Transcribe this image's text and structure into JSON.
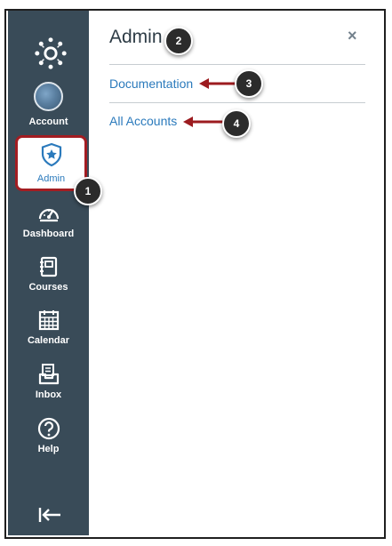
{
  "nav": {
    "items": [
      {
        "label": "Account",
        "icon": "account-avatar"
      },
      {
        "label": "Admin",
        "icon": "shield-star-icon"
      },
      {
        "label": "Dashboard",
        "icon": "speedometer-icon"
      },
      {
        "label": "Courses",
        "icon": "book-icon"
      },
      {
        "label": "Calendar",
        "icon": "calendar-icon"
      },
      {
        "label": "Inbox",
        "icon": "inbox-icon"
      },
      {
        "label": "Help",
        "icon": "question-icon"
      }
    ],
    "collapse_icon": "collapse-arrow-icon",
    "color": "#394b58",
    "highlight_color": "#a31d22"
  },
  "panel": {
    "title": "Admin",
    "close_glyph": "×",
    "links": [
      "Documentation",
      "All Accounts"
    ],
    "link_color": "#2b7abc"
  },
  "callouts": [
    "1",
    "2",
    "3",
    "4"
  ]
}
